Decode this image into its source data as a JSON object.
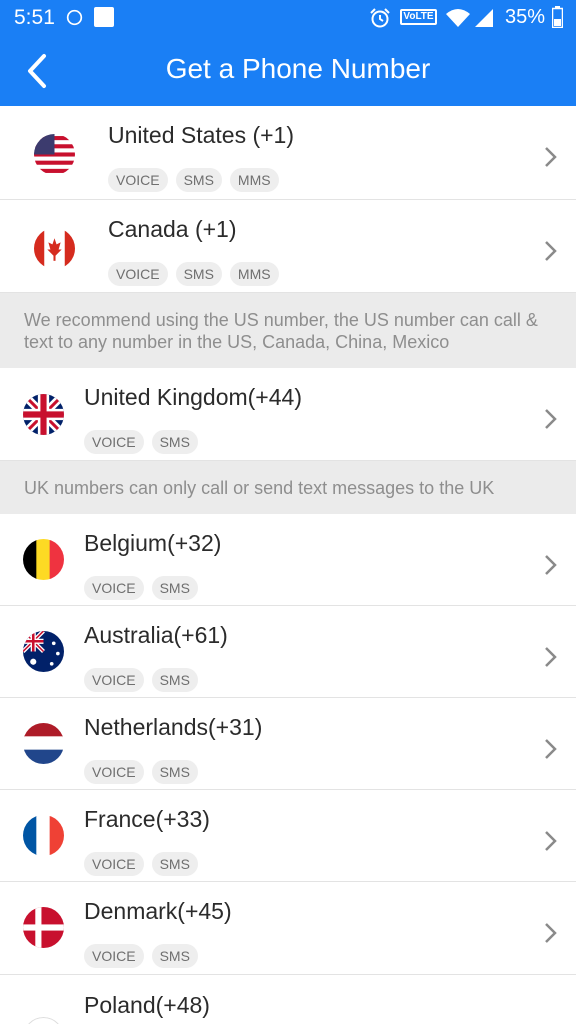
{
  "status_bar": {
    "time": "5:51",
    "volte": "VoLTE",
    "battery": "35%"
  },
  "header": {
    "title": "Get a Phone Number"
  },
  "tags": {
    "voice": "VOICE",
    "sms": "SMS",
    "mms": "MMS"
  },
  "countries": [
    {
      "name": "United States (+1)",
      "flag": "us-flag-icon",
      "tags": [
        "VOICE",
        "SMS",
        "MMS"
      ]
    },
    {
      "name": "Canada (+1)",
      "flag": "canada-flag-icon",
      "tags": [
        "VOICE",
        "SMS",
        "MMS"
      ]
    },
    {
      "name": "United Kingdom(+44)",
      "flag": "uk-flag-icon",
      "tags": [
        "VOICE",
        "SMS"
      ]
    },
    {
      "name": "Belgium(+32)",
      "flag": "belgium-flag-icon",
      "tags": [
        "VOICE",
        "SMS"
      ]
    },
    {
      "name": "Australia(+61)",
      "flag": "australia-flag-icon",
      "tags": [
        "VOICE",
        "SMS"
      ]
    },
    {
      "name": "Netherlands(+31)",
      "flag": "netherlands-flag-icon",
      "tags": [
        "VOICE",
        "SMS"
      ]
    },
    {
      "name": "France(+33)",
      "flag": "france-flag-icon",
      "tags": [
        "VOICE",
        "SMS"
      ]
    },
    {
      "name": "Denmark(+45)",
      "flag": "denmark-flag-icon",
      "tags": [
        "VOICE",
        "SMS"
      ]
    },
    {
      "name": "Poland(+48)",
      "flag": "poland-flag-icon",
      "tags": []
    }
  ],
  "notes": {
    "us": "We recommend using the US number, the US number can call & text to any number in the US, Canada, China, Mexico",
    "uk": "UK numbers can only call or send text messages to the UK"
  },
  "colors": {
    "appbar": "#1a7ff5",
    "note_bg": "#ebebeb"
  }
}
